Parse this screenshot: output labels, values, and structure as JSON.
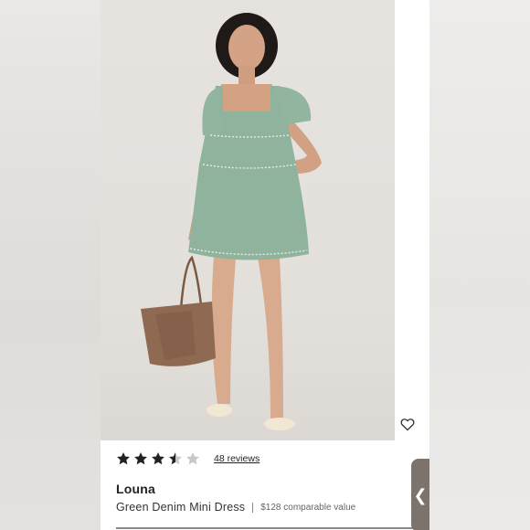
{
  "product": {
    "rating": 3.5,
    "rating_max": 5,
    "reviews_label": "48 reviews",
    "brand": "Louna",
    "name": "Green Denim Mini Dress",
    "price_note": "$128 comparable value"
  },
  "icons": {
    "star": "star-icon",
    "wishlist": "heart-icon",
    "side_tab": "chevron-left-icon"
  },
  "side_tab": {
    "glyph": "❮"
  },
  "colors": {
    "star_filled": "#222222",
    "star_empty": "#c8c8c8",
    "dress": "#8fb39d",
    "background": "#e5e2de"
  }
}
